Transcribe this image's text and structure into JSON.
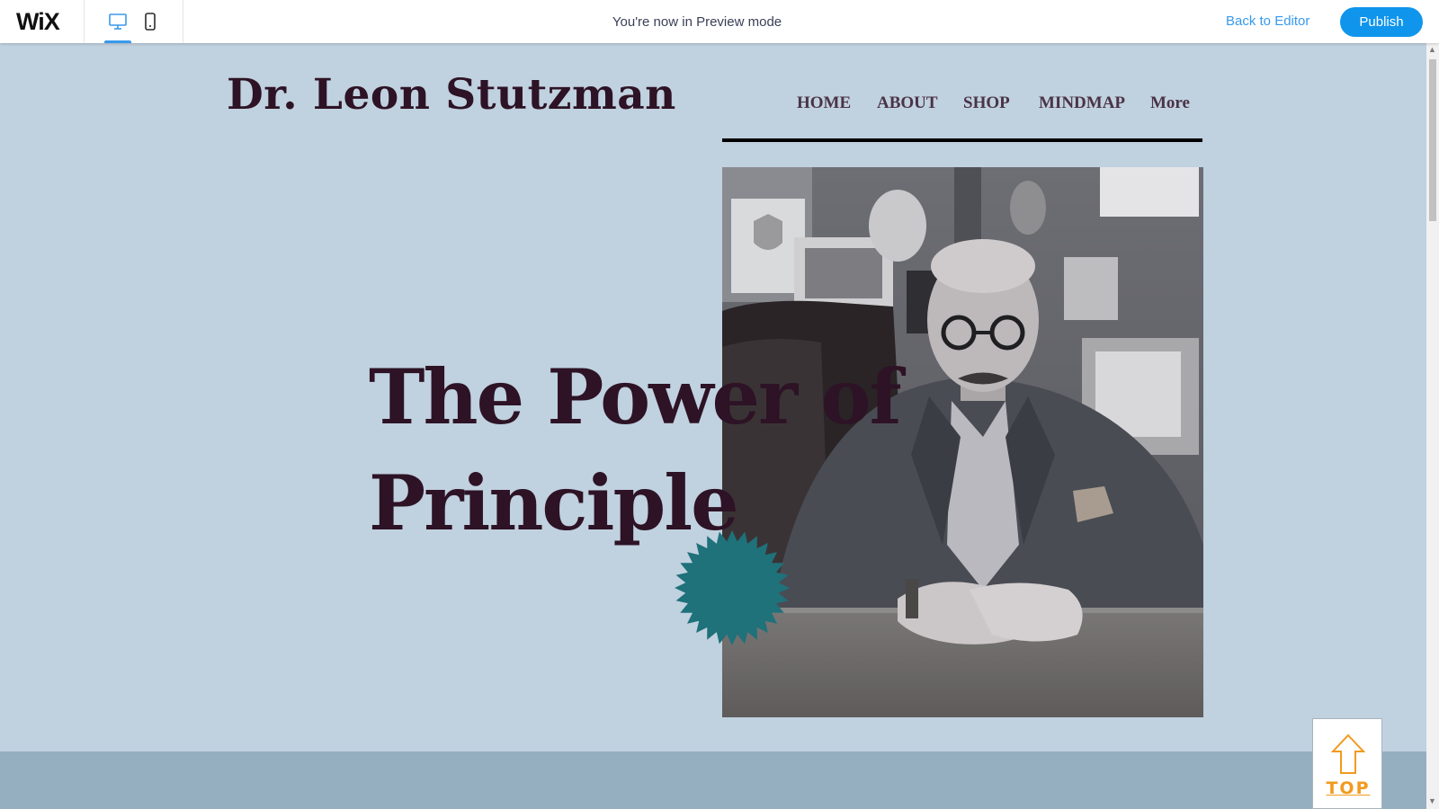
{
  "topbar": {
    "logo": "WiX",
    "preview_message": "You're now in Preview mode",
    "back_to_editor": "Back to Editor",
    "publish": "Publish",
    "active_device": "desktop",
    "colors": {
      "accent": "#3899ec",
      "publish_bg": "#0f95ec"
    }
  },
  "site": {
    "title": "Dr. Leon Stutzman",
    "nav": [
      "HOME",
      "ABOUT",
      "SHOP",
      "MINDMAP",
      "More"
    ],
    "hero_line1": "The Power of",
    "hero_line2": "Principle",
    "top_button": "TOP",
    "colors": {
      "background": "#c0d1df",
      "title": "#2d1325",
      "star": "#1f717a",
      "band": "#96afc0",
      "top_accent": "#f29a1f"
    }
  }
}
